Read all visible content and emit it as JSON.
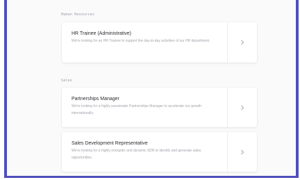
{
  "sections": [
    {
      "label": "Human Resources",
      "jobs": [
        {
          "title": "HR Trainee (Administrative)",
          "description": "We're looking for an HR Trainee to support the day-to-day activities of our HR department."
        }
      ]
    },
    {
      "label": "Sales",
      "jobs": [
        {
          "title": "Partnerships Manager",
          "description": "We're looking for a highly passionate Partnerships Manager to accelerate our growth internationally."
        },
        {
          "title": "Sales Development Representative",
          "description": "We're looking for a highly energetic and dynamic SDR to identify and generate sales opportunities."
        }
      ]
    }
  ],
  "icons": {
    "open_job": "chevron-right-icon"
  },
  "colors": {
    "frame_border": "#4e4fbb",
    "page_bg": "#fafafb",
    "card_bg": "#ffffff"
  }
}
